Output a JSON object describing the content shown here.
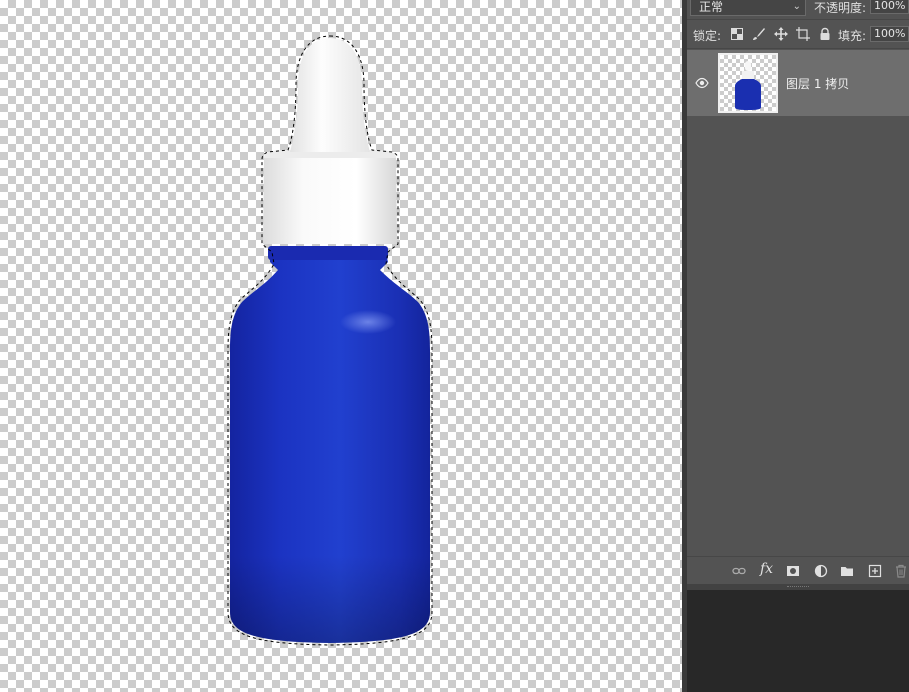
{
  "layers_panel": {
    "blend_mode": "正常",
    "opacity_label": "不透明度:",
    "opacity_value": "100%",
    "lock_label": "锁定:",
    "fill_label": "填充:",
    "fill_value": "100%",
    "lock_icons": [
      "lock-transparent-pixels-icon",
      "lock-image-pixels-icon",
      "lock-position-icon",
      "lock-artboard-icon",
      "lock-all-icon"
    ],
    "layers": [
      {
        "name": "图层 1 拷贝",
        "visible": true,
        "selected": true
      }
    ],
    "bottom_icons": [
      "link-layers-icon",
      "fx-icon",
      "add-mask-icon",
      "adjustment-layer-icon",
      "new-group-icon",
      "new-layer-icon",
      "delete-layer-icon"
    ],
    "fx_text": "fx"
  },
  "canvas": {
    "background": "transparent-checkerboard",
    "content": "blue-dropper-bottle-with-white-cap",
    "selection": "marching-ants-around-bottle"
  },
  "colors": {
    "bottle_blue": "#1a2fb0",
    "cap_white": "#f4f4f4",
    "panel_bg": "#535353",
    "selected_layer_bg": "#6e6e6e"
  }
}
